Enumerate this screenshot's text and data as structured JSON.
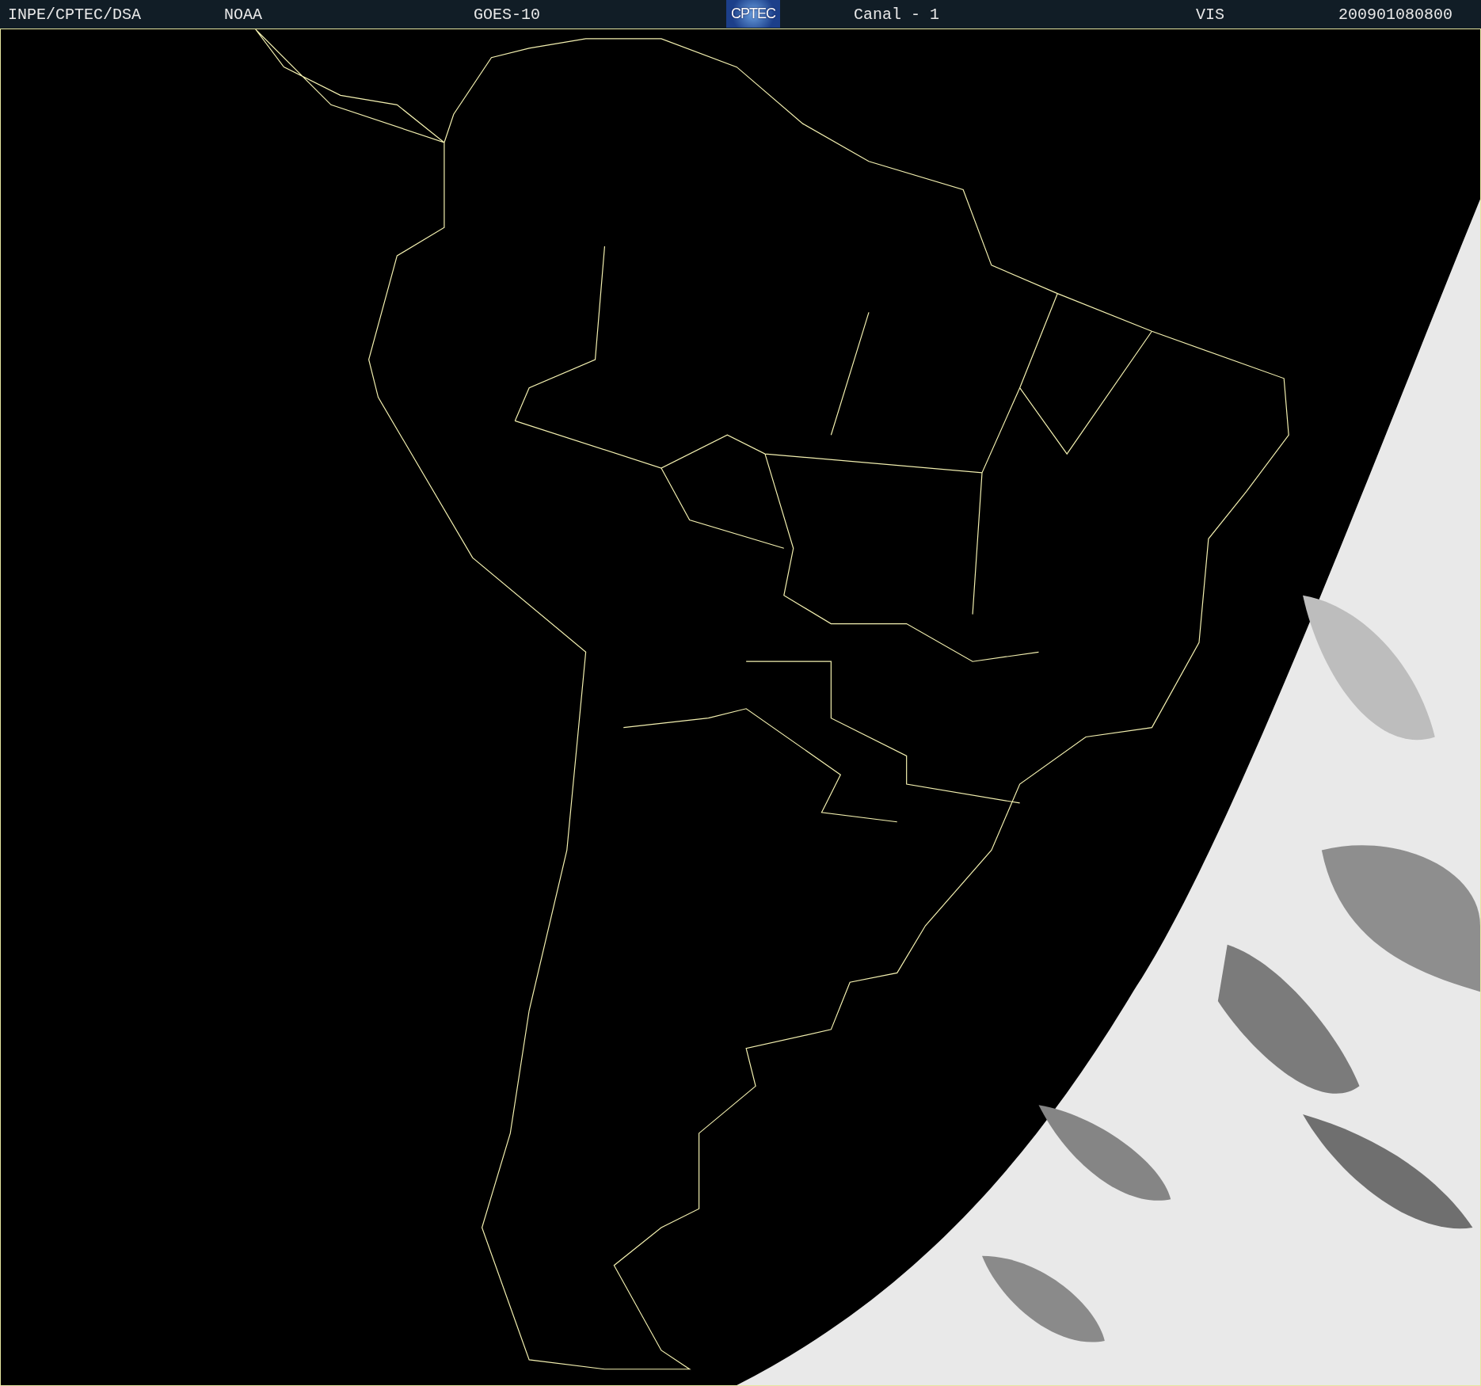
{
  "header": {
    "items": [
      {
        "kind": "text",
        "text": "INPE/CPTEC/DSA"
      },
      {
        "kind": "text",
        "text": "NOAA"
      },
      {
        "kind": "text",
        "text": "GOES-10"
      },
      {
        "kind": "logo",
        "text": "CPTEC"
      },
      {
        "kind": "text",
        "text": "Canal - 1"
      },
      {
        "kind": "text",
        "text": "VIS"
      },
      {
        "kind": "text",
        "text": "200901080800"
      }
    ]
  }
}
